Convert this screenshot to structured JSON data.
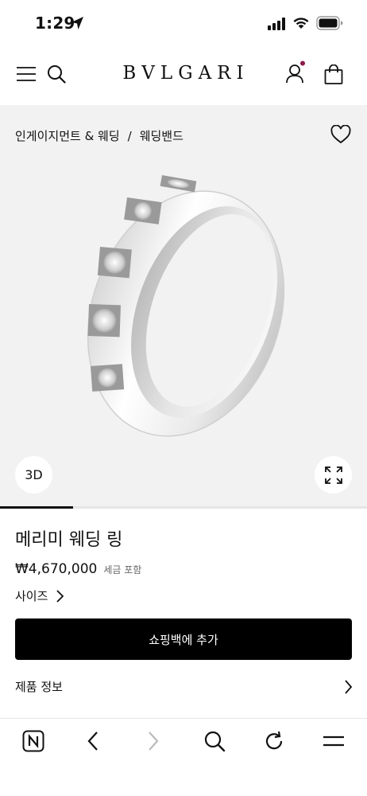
{
  "status": {
    "time": "1:29"
  },
  "header": {
    "logo": "BVLGARI"
  },
  "breadcrumb": {
    "items": [
      "인게이지먼트 & 웨딩",
      "웨딩밴드"
    ],
    "separator": "/"
  },
  "hero": {
    "badge_3d": "3D",
    "carousel_progress": 0.2
  },
  "product": {
    "name": "메리미 웨딩 링",
    "price": "₩4,670,000",
    "tax_note": "세금 포함",
    "size_label": "사이즈",
    "add_to_bag": "쇼핑백에 추가",
    "info_label": "제품 정보"
  },
  "colors": {
    "accent_dot": "#8b1a4a",
    "button_bg": "#000000",
    "hero_bg": "#f2f2f2"
  },
  "toolbar": {
    "icons": [
      "n-icon",
      "back-icon",
      "forward-icon",
      "search-icon",
      "reload-icon",
      "menu-icon"
    ]
  }
}
